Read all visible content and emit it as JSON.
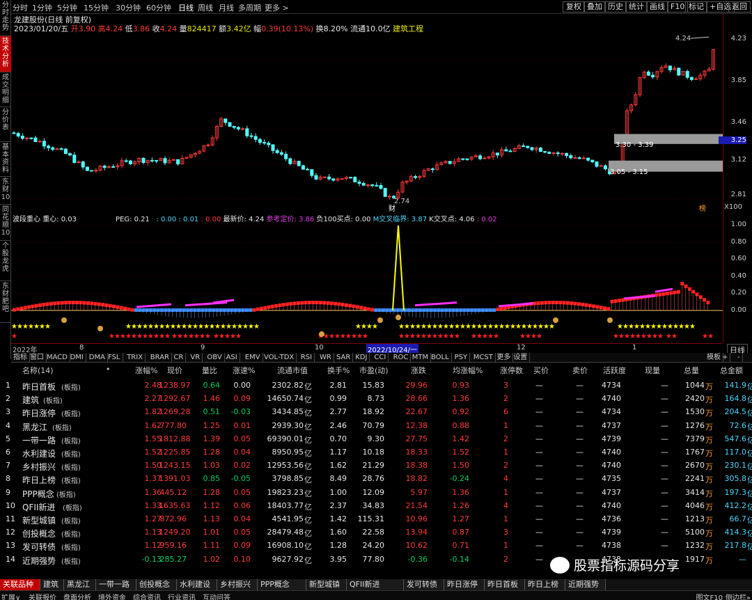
{
  "side_tabs": [
    "分时走势",
    "技术分析",
    "成交明细",
    "分价表",
    "基本资料",
    "东财10",
    "同花顺10",
    "个股龙虎",
    "东财肥吧"
  ],
  "side_active": 1,
  "period_tabs": [
    "分时",
    "1分钟",
    "5分钟",
    "15分钟",
    "30分钟",
    "60分钟",
    "日线",
    "周线",
    "月线",
    "多周期",
    "更多 >"
  ],
  "period_active": 6,
  "right_tools": [
    "复权",
    "叠加",
    "历史",
    "统计",
    "画线",
    "F10",
    "标记",
    "+自选",
    "返回"
  ],
  "stock": {
    "title": "龙建股份(日线 前复权)",
    "date": "2023/01/20/五",
    "open_label": "开",
    "open": "3.90",
    "high_label": "高",
    "high": "4.24",
    "low_label": "低",
    "low": "3.86",
    "close_label": "收",
    "close": "4.24",
    "vol_label": "量",
    "vol": "824417",
    "amt_label": "额",
    "amt": "3.42亿",
    "chg_label": "幅",
    "chg": "0.39(10.13%)",
    "turn": "换8.20%",
    "float": "流通10.0亿",
    "sector": "建筑工程"
  },
  "price_axis": [
    "4.23",
    "3.85",
    "3.46",
    "3.25",
    "3.12",
    "2.81"
  ],
  "price_marks": {
    "high": "4.24",
    "low": "2.74",
    "zone1": "3.30 - 3.39",
    "zone2": "3.05 - 3.15",
    "cai": "财",
    "bang": "榜",
    "x100": "X100"
  },
  "indicator": {
    "name": "波段重心",
    "zx": "重心: 0.03",
    "peg": "PEG: 0.21",
    "v1": ": 0.00",
    "v2": ": 0.01",
    "v3": ": 0.00",
    "latest": "最新价: 4.24",
    "ref": "参考定价: 3.86",
    "fu": "负100买点: 0.00",
    "mcross": "M交叉临界: 3.87",
    "kcross": "K交叉点: 4.06",
    "last": ": 0.02"
  },
  "ind_axis": [
    "1.00",
    "0.80",
    "0.60",
    "0.40",
    "0.20",
    "0.00"
  ],
  "time_axis": {
    "y2022": "2022年",
    "m8": "8",
    "m9": "9",
    "m10": "10",
    "sel": "2022/10/24/一",
    "m12": "12",
    "m1": "1",
    "daily": "日线"
  },
  "ind_tabs": [
    "指标",
    "窗口",
    "MACD",
    "DMI",
    "DMA",
    "FSL",
    "TRIX",
    "BRAR",
    "CR",
    "VR",
    "OBV",
    "ASI",
    "EMV",
    "VOL-TDX",
    "RSI",
    "WR",
    "SAR",
    "KDJ",
    "CCI",
    "ROC",
    "MTM",
    "BOLL",
    "PSY",
    "MCST",
    "更多",
    "设置"
  ],
  "ind_right": [
    "模板",
    "+",
    "-"
  ],
  "table": {
    "headers": [
      "名称(14)",
      "•",
      "涨幅%",
      "现价",
      "量比",
      "涨速%",
      "流通市值",
      "换手%",
      "市盈(动)",
      "涨跌",
      "均涨幅%",
      "涨停数",
      "买价",
      "卖价",
      "活跃度",
      "现量",
      "总量",
      "总金额"
    ],
    "rows": [
      {
        "no": "1",
        "name": "昨日首板",
        "tag": "(板指)",
        "chg": "2.48",
        "price": "1238.97",
        "qr": "0.64",
        "spd": "0.00",
        "mcap": "2302.82",
        "unit": "亿",
        "turn": "2.81",
        "pe": "15.83",
        "diff": "29.96",
        "avg": "0.93",
        "lim": "3",
        "buy": "—",
        "sell": "—",
        "act": "4734",
        "cur": "—",
        "vol": "1044",
        "vu": "万",
        "amt": "141.9",
        "au": "亿"
      },
      {
        "no": "2",
        "name": "建筑",
        "tag": "(板指)",
        "chg": "2.27",
        "price": "1292.67",
        "qr": "1.46",
        "spd": "0.09",
        "mcap": "14650.74",
        "unit": "亿",
        "turn": "0.99",
        "pe": "8.73",
        "diff": "28.66",
        "avg": "1.36",
        "lim": "2",
        "buy": "—",
        "sell": "—",
        "act": "4740",
        "cur": "—",
        "vol": "2420",
        "vu": "万",
        "amt": "164.8",
        "au": "亿"
      },
      {
        "no": "3",
        "name": "昨日涨停",
        "tag": "(板指)",
        "chg": "1.82",
        "price": "1269.28",
        "qr": "0.51",
        "spd": "-0.03",
        "mcap": "3434.85",
        "unit": "亿",
        "turn": "2.77",
        "pe": "18.92",
        "diff": "22.67",
        "avg": "0.92",
        "lim": "6",
        "buy": "—",
        "sell": "—",
        "act": "4734",
        "cur": "—",
        "vol": "1530",
        "vu": "万",
        "amt": "204.5",
        "au": "亿"
      },
      {
        "no": "4",
        "name": "黑龙江",
        "tag": "(板指)",
        "chg": "1.62",
        "price": "777.80",
        "qr": "1.25",
        "spd": "0.01",
        "mcap": "2939.30",
        "unit": "亿",
        "turn": "2.46",
        "pe": "70.79",
        "diff": "12.38",
        "avg": "0.88",
        "lim": "1",
        "buy": "—",
        "sell": "—",
        "act": "4737",
        "cur": "—",
        "vol": "1276",
        "vu": "万",
        "amt": "72.6",
        "au": "亿"
      },
      {
        "no": "5",
        "name": "一带一路",
        "tag": "(板指)",
        "chg": "1.55",
        "price": "1812.88",
        "qr": "1.39",
        "spd": "0.05",
        "mcap": "69390.01",
        "unit": "亿",
        "turn": "0.70",
        "pe": "9.30",
        "diff": "27.75",
        "avg": "1.42",
        "lim": "2",
        "buy": "—",
        "sell": "—",
        "act": "4739",
        "cur": "—",
        "vol": "7379",
        "vu": "万",
        "amt": "547.6",
        "au": "亿"
      },
      {
        "no": "6",
        "name": "水利建设",
        "tag": "(板指)",
        "chg": "1.52",
        "price": "1225.85",
        "qr": "1.28",
        "spd": "0.04",
        "mcap": "8950.95",
        "unit": "亿",
        "turn": "1.17",
        "pe": "10.18",
        "diff": "18.33",
        "avg": "1.52",
        "lim": "1",
        "buy": "—",
        "sell": "—",
        "act": "4740",
        "cur": "—",
        "vol": "1767",
        "vu": "万",
        "amt": "117.0",
        "au": "亿"
      },
      {
        "no": "7",
        "name": "乡村振兴",
        "tag": "(板指)",
        "chg": "1.50",
        "price": "1243.15",
        "qr": "1.03",
        "spd": "0.02",
        "mcap": "12953.56",
        "unit": "亿",
        "turn": "1.62",
        "pe": "21.29",
        "diff": "18.38",
        "avg": "1.50",
        "lim": "2",
        "buy": "—",
        "sell": "—",
        "act": "4740",
        "cur": "—",
        "vol": "2670",
        "vu": "万",
        "amt": "230.1",
        "au": "亿"
      },
      {
        "no": "8",
        "name": "昨日上榜",
        "tag": "(板指)",
        "chg": "1.37",
        "price": "1391.03",
        "qr": "0.85",
        "spd": "-0.05",
        "mcap": "3798.85",
        "unit": "亿",
        "turn": "8.49",
        "pe": "28.76",
        "diff": "18.82",
        "avg": "-0.24",
        "lim": "4",
        "buy": "—",
        "sell": "—",
        "act": "4735",
        "cur": "—",
        "vol": "2241",
        "vu": "万",
        "amt": "305.8",
        "au": "亿"
      },
      {
        "no": "9",
        "name": "PPP概念",
        "tag": "(板指)",
        "chg": "1.36",
        "price": "445.12",
        "qr": "1.28",
        "spd": "0.05",
        "mcap": "19823.23",
        "unit": "亿",
        "turn": "1.00",
        "pe": "12.09",
        "diff": "5.97",
        "avg": "1.36",
        "lim": "1",
        "buy": "—",
        "sell": "—",
        "act": "4737",
        "cur": "—",
        "vol": "3414",
        "vu": "万",
        "amt": "197.3",
        "au": "亿"
      },
      {
        "no": "10",
        "name": "QFII新进",
        "tag": "(板指)",
        "chg": "1.33",
        "price": "1635.63",
        "qr": "1.12",
        "spd": "0.06",
        "mcap": "18403.77",
        "unit": "亿",
        "turn": "2.37",
        "pe": "34.83",
        "diff": "21.54",
        "avg": "1.26",
        "lim": "4",
        "buy": "—",
        "sell": "—",
        "act": "4740",
        "cur": "—",
        "vol": "4046",
        "vu": "万",
        "amt": "412.2",
        "au": "亿"
      },
      {
        "no": "11",
        "name": "新型城镇",
        "tag": "(板指)",
        "chg": "1.27",
        "price": "872.96",
        "qr": "1.13",
        "spd": "0.04",
        "mcap": "4541.95",
        "unit": "亿",
        "turn": "1.42",
        "pe": "115.31",
        "diff": "10.96",
        "avg": "1.27",
        "lim": "1",
        "buy": "—",
        "sell": "—",
        "act": "4736",
        "cur": "—",
        "vol": "1213",
        "vu": "万",
        "amt": "66.7",
        "au": "亿"
      },
      {
        "no": "12",
        "name": "创投概念",
        "tag": "(板指)",
        "chg": "1.13",
        "price": "1249.20",
        "qr": "1.01",
        "spd": "0.05",
        "mcap": "28479.48",
        "unit": "亿",
        "turn": "1.60",
        "pe": "22.58",
        "diff": "13.94",
        "avg": "0.87",
        "lim": "3",
        "buy": "—",
        "sell": "—",
        "act": "4739",
        "cur": "—",
        "vol": "5100",
        "vu": "万",
        "amt": "414.3",
        "au": "亿"
      },
      {
        "no": "13",
        "name": "发可转债",
        "tag": "(板指)",
        "chg": "1.12",
        "price": "959.16",
        "qr": "1.11",
        "spd": "0.09",
        "mcap": "16908.10",
        "unit": "亿",
        "turn": "1.28",
        "pe": "24.20",
        "diff": "10.62",
        "avg": "0.71",
        "lim": "1",
        "buy": "—",
        "sell": "—",
        "act": "4738",
        "cur": "—",
        "vol": "1232",
        "vu": "万",
        "amt": "217.8",
        "au": "亿"
      },
      {
        "no": "14",
        "name": "近期强势",
        "tag": "(板指)",
        "chg": "-0.13",
        "price": "285.27",
        "qr": "1.02",
        "spd": "0.10",
        "mcap": "9627.92",
        "unit": "亿",
        "turn": "3.95",
        "pe": "77.80",
        "diff": "-0.36",
        "avg": "-0.14",
        "lim": "2",
        "buy": "—",
        "sell": "—",
        "act": "4738",
        "cur": "—",
        "vol": "1917",
        "vu": "万",
        "amt": "—",
        "au": ""
      }
    ]
  },
  "bottom_tabs": [
    "关联品种",
    "建筑",
    "黑龙江",
    "一带一路",
    "创投概念",
    "水利建设",
    "乡村振兴",
    "PPP概念",
    "新型城镇",
    "QFII新进",
    "发可转债",
    "昨日涨停",
    "昨日首板",
    "昨日上榜",
    "近期强势"
  ],
  "bottom_active": 0,
  "status_tabs": [
    "扩展∨",
    "关联报价",
    "盘面分析",
    "境外资金",
    "综合资讯",
    "行业资讯",
    "互动问答"
  ],
  "status_right": "图文F10",
  "status_right2": "侧边栏»",
  "watermark": "股票指标源码分享",
  "colors": {
    "up": "#ff3a3a",
    "down": "#00d060",
    "candle_down": "#54ffff",
    "active": "#c00000",
    "yellow": "#ffff00",
    "magenta": "#ff30ff"
  }
}
